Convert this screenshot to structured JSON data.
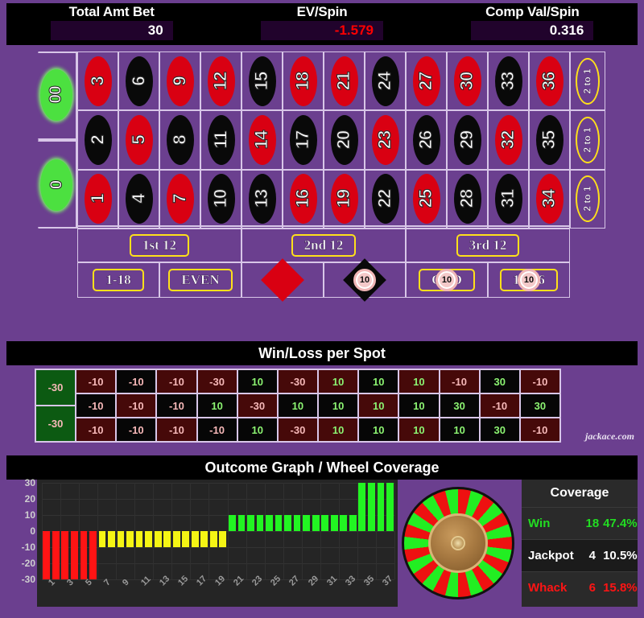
{
  "header": {
    "stats": [
      {
        "label": "Total Amt Bet",
        "value": "30",
        "negative": false
      },
      {
        "label": "EV/Spin",
        "value": "-1.579",
        "negative": true
      },
      {
        "label": "Comp Val/Spin",
        "value": "0.316",
        "negative": false
      }
    ]
  },
  "table": {
    "zeros": [
      {
        "name": "00",
        "label": "00"
      },
      {
        "name": "0",
        "label": "0"
      }
    ],
    "numbers": [
      {
        "n": "3",
        "color": "red"
      },
      {
        "n": "6",
        "color": "black"
      },
      {
        "n": "9",
        "color": "red"
      },
      {
        "n": "12",
        "color": "red"
      },
      {
        "n": "15",
        "color": "black"
      },
      {
        "n": "18",
        "color": "red"
      },
      {
        "n": "21",
        "color": "red"
      },
      {
        "n": "24",
        "color": "black"
      },
      {
        "n": "27",
        "color": "red"
      },
      {
        "n": "30",
        "color": "red"
      },
      {
        "n": "33",
        "color": "black"
      },
      {
        "n": "36",
        "color": "red"
      },
      {
        "n": "2",
        "color": "black"
      },
      {
        "n": "5",
        "color": "red"
      },
      {
        "n": "8",
        "color": "black"
      },
      {
        "n": "11",
        "color": "black"
      },
      {
        "n": "14",
        "color": "red"
      },
      {
        "n": "17",
        "color": "black"
      },
      {
        "n": "20",
        "color": "black"
      },
      {
        "n": "23",
        "color": "red"
      },
      {
        "n": "26",
        "color": "black"
      },
      {
        "n": "29",
        "color": "black"
      },
      {
        "n": "32",
        "color": "red"
      },
      {
        "n": "35",
        "color": "black"
      },
      {
        "n": "1",
        "color": "red"
      },
      {
        "n": "4",
        "color": "black"
      },
      {
        "n": "7",
        "color": "red"
      },
      {
        "n": "10",
        "color": "black"
      },
      {
        "n": "13",
        "color": "black"
      },
      {
        "n": "16",
        "color": "red"
      },
      {
        "n": "19",
        "color": "red"
      },
      {
        "n": "22",
        "color": "black"
      },
      {
        "n": "25",
        "color": "red"
      },
      {
        "n": "28",
        "color": "black"
      },
      {
        "n": "31",
        "color": "black"
      },
      {
        "n": "34",
        "color": "red"
      }
    ],
    "column_bets": [
      {
        "label": "2 to 1"
      },
      {
        "label": "2 to 1"
      },
      {
        "label": "2 to 1"
      }
    ],
    "dozens": [
      {
        "label": "1st 12"
      },
      {
        "label": "2nd 12"
      },
      {
        "label": "3rd 12"
      }
    ],
    "even_money": [
      {
        "label": "1-18",
        "kind": "text",
        "chip": null
      },
      {
        "label": "EVEN",
        "kind": "text",
        "chip": null
      },
      {
        "label": "RED",
        "kind": "diamond-red",
        "chip": null
      },
      {
        "label": "BLACK",
        "kind": "diamond-black",
        "chip": "10"
      },
      {
        "label": "ODD",
        "kind": "text",
        "chip": "10"
      },
      {
        "label": "19-36",
        "kind": "text",
        "chip": "10"
      }
    ]
  },
  "winloss": {
    "title": "Win/Loss per Spot",
    "zero_cells": [
      {
        "label": "00",
        "value": "-30"
      },
      {
        "label": "0",
        "value": "-30"
      }
    ],
    "cells": [
      {
        "n": "3",
        "color": "red",
        "value": "-10"
      },
      {
        "n": "6",
        "color": "black",
        "value": "-10"
      },
      {
        "n": "9",
        "color": "red",
        "value": "-10"
      },
      {
        "n": "12",
        "color": "red",
        "value": "-30"
      },
      {
        "n": "15",
        "color": "black",
        "value": "10"
      },
      {
        "n": "18",
        "color": "red",
        "value": "-30"
      },
      {
        "n": "21",
        "color": "red",
        "value": "10"
      },
      {
        "n": "24",
        "color": "black",
        "value": "10"
      },
      {
        "n": "27",
        "color": "red",
        "value": "10"
      },
      {
        "n": "30",
        "color": "red",
        "value": "-10"
      },
      {
        "n": "33",
        "color": "black",
        "value": "30"
      },
      {
        "n": "36",
        "color": "red",
        "value": "-10"
      },
      {
        "n": "2",
        "color": "black",
        "value": "-10"
      },
      {
        "n": "5",
        "color": "red",
        "value": "-10"
      },
      {
        "n": "8",
        "color": "black",
        "value": "-10"
      },
      {
        "n": "11",
        "color": "black",
        "value": "10"
      },
      {
        "n": "14",
        "color": "red",
        "value": "-30"
      },
      {
        "n": "17",
        "color": "black",
        "value": "10"
      },
      {
        "n": "20",
        "color": "black",
        "value": "10"
      },
      {
        "n": "23",
        "color": "red",
        "value": "10"
      },
      {
        "n": "26",
        "color": "black",
        "value": "10"
      },
      {
        "n": "29",
        "color": "black",
        "value": "30"
      },
      {
        "n": "32",
        "color": "red",
        "value": "-10"
      },
      {
        "n": "35",
        "color": "black",
        "value": "30"
      },
      {
        "n": "1",
        "color": "red",
        "value": "-10"
      },
      {
        "n": "4",
        "color": "black",
        "value": "-10"
      },
      {
        "n": "7",
        "color": "red",
        "value": "-10"
      },
      {
        "n": "10",
        "color": "black",
        "value": "-10"
      },
      {
        "n": "13",
        "color": "black",
        "value": "10"
      },
      {
        "n": "16",
        "color": "red",
        "value": "-30"
      },
      {
        "n": "19",
        "color": "red",
        "value": "10"
      },
      {
        "n": "22",
        "color": "black",
        "value": "10"
      },
      {
        "n": "25",
        "color": "red",
        "value": "10"
      },
      {
        "n": "28",
        "color": "black",
        "value": "10"
      },
      {
        "n": "31",
        "color": "black",
        "value": "30"
      },
      {
        "n": "34",
        "color": "red",
        "value": "-10"
      }
    ]
  },
  "brand": "jackace.com",
  "outcome": {
    "title": "Outcome Graph / Wheel Coverage"
  },
  "coverage": {
    "title": "Coverage",
    "rows": [
      {
        "name": "Win",
        "count": "18",
        "pct": "47.4%",
        "style": "cv-win"
      },
      {
        "name": "Jackpot",
        "count": "4",
        "pct": "10.5%",
        "style": "cv-jack"
      },
      {
        "name": "Whack",
        "count": "6",
        "pct": "15.8%",
        "style": "cv-whack"
      }
    ]
  },
  "chart_data": {
    "type": "bar",
    "title": "Outcome Graph / Wheel Coverage",
    "xlabel": "",
    "ylabel": "",
    "ylim": [
      -30,
      30
    ],
    "yticks": [
      30,
      20,
      10,
      0,
      -10,
      -20,
      -30
    ],
    "xticks": [
      "1",
      "3",
      "5",
      "7",
      "9",
      "11",
      "13",
      "15",
      "17",
      "19",
      "21",
      "23",
      "25",
      "27",
      "29",
      "31",
      "33",
      "35",
      "37"
    ],
    "grid": true,
    "legend": "none",
    "categories": [
      "1",
      "2",
      "3",
      "4",
      "5",
      "6",
      "7",
      "8",
      "9",
      "10",
      "11",
      "12",
      "13",
      "14",
      "15",
      "16",
      "17",
      "18",
      "19",
      "20",
      "21",
      "22",
      "23",
      "24",
      "25",
      "26",
      "27",
      "28",
      "29",
      "30",
      "31",
      "32",
      "33",
      "34",
      "35",
      "36",
      "37",
      "38"
    ],
    "values": [
      -30,
      -30,
      -30,
      -30,
      -30,
      -30,
      -10,
      -10,
      -10,
      -10,
      -10,
      -10,
      -10,
      -10,
      -10,
      -10,
      -10,
      -10,
      -10,
      -10,
      10,
      10,
      10,
      10,
      10,
      10,
      10,
      10,
      10,
      10,
      10,
      10,
      10,
      10,
      30,
      30,
      30,
      30
    ],
    "colors": [
      "red",
      "red",
      "red",
      "red",
      "red",
      "red",
      "yellow",
      "yellow",
      "yellow",
      "yellow",
      "yellow",
      "yellow",
      "yellow",
      "yellow",
      "yellow",
      "yellow",
      "yellow",
      "yellow",
      "yellow",
      "yellow",
      "green",
      "green",
      "green",
      "green",
      "green",
      "green",
      "green",
      "green",
      "green",
      "green",
      "green",
      "green",
      "green",
      "green",
      "green",
      "green",
      "green",
      "green"
    ]
  },
  "wheel": {
    "segments": 26,
    "segment_colors": [
      "red",
      "green"
    ]
  }
}
